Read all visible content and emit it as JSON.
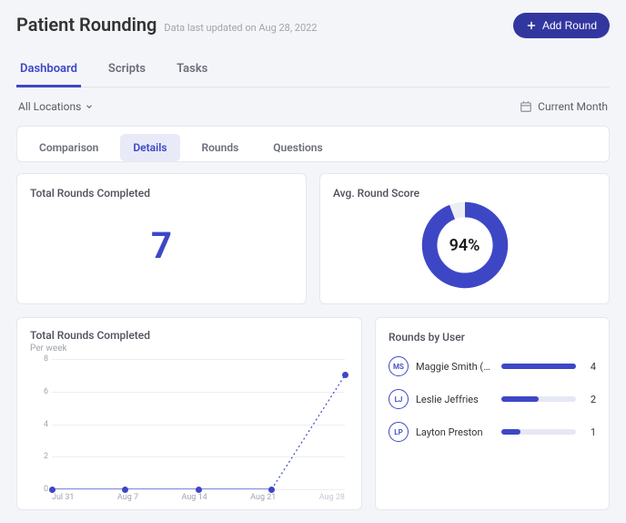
{
  "header": {
    "title": "Patient Rounding",
    "subtitle": "Data last updated on Aug 28, 2022",
    "add_button_label": "Add Round"
  },
  "main_tabs": [
    "Dashboard",
    "Scripts",
    "Tasks"
  ],
  "main_tab_active": 0,
  "filter": {
    "location_label": "All Locations",
    "period_label": "Current Month"
  },
  "sub_tabs": [
    "Comparison",
    "Details",
    "Rounds",
    "Questions"
  ],
  "sub_tab_active": 1,
  "kpi": {
    "total_title": "Total Rounds Completed",
    "total_value": "7",
    "score_title": "Avg. Round Score",
    "score_percent": 94,
    "score_text": "94%"
  },
  "chart_data": {
    "type": "line",
    "title": "Total Rounds Completed",
    "subtitle": "Per week",
    "xlabel": "",
    "ylabel": "",
    "x": [
      "Jul 31",
      "Aug 7",
      "Aug 14",
      "Aug 21",
      "Aug 28"
    ],
    "y": [
      0,
      0,
      0,
      0,
      7
    ],
    "ylim": [
      0,
      8
    ],
    "y_ticks": [
      0,
      2,
      4,
      6,
      8
    ]
  },
  "users": {
    "title": "Rounds by User",
    "max": 4,
    "items": [
      {
        "initials": "MS",
        "name": "Maggie Smith (Y…",
        "count": 4
      },
      {
        "initials": "LJ",
        "name": "Leslie Jeffries",
        "count": 2
      },
      {
        "initials": "LP",
        "name": "Layton Preston",
        "count": 1
      }
    ]
  }
}
